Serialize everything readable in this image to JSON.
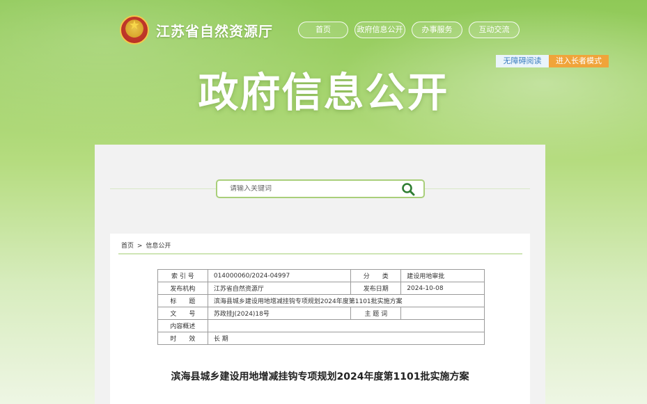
{
  "header": {
    "site_title": "江苏省自然资源厅",
    "hero_title": "政府信息公开",
    "nav": [
      {
        "label": "首页"
      },
      {
        "label": "政府信息公开"
      },
      {
        "label": "办事服务"
      },
      {
        "label": "互动交流"
      }
    ],
    "accessible_label": "无障碍阅读",
    "elder_mode_label": "进入长者模式"
  },
  "search": {
    "placeholder": "请输入关键词"
  },
  "breadcrumb": {
    "home": "首页",
    "separator": ">",
    "current": "信息公开"
  },
  "meta_table": {
    "index_label": "索 引 号",
    "index_value": "014000060/2024-04997",
    "category_label": "分　　类",
    "category_value": "建设用地审批",
    "publisher_label": "发布机构",
    "publisher_value": "江苏省自然资源厅",
    "date_label": "发布日期",
    "date_value": "2024-10-08",
    "title_label": "标　　题",
    "title_value": "滨海县城乡建设用地增减挂钩专项规划2024年度第1101批实施方案",
    "doc_no_label": "文　　号",
    "doc_no_value": "苏政挂J(2024)18号",
    "subject_label": "主 题 词",
    "subject_value": "",
    "summary_label": "内容概述",
    "summary_value": "",
    "validity_label": "时　　效",
    "validity_value": "长 期"
  },
  "document": {
    "title": "滨海县城乡建设用地增减挂钩专项规划2024年度第1101批实施方案"
  },
  "colors": {
    "brand_green": "#8fc957",
    "accent_orange": "#f0a43a",
    "search_green": "#2e7d32"
  }
}
